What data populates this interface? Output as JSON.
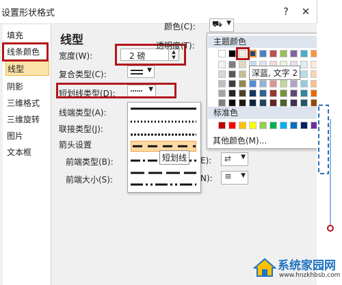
{
  "dialog": {
    "title": "设置形状格式",
    "minimize": "?",
    "close": "✕"
  },
  "nav": {
    "items": [
      "填充",
      "线条颜色",
      "线型",
      "阴影",
      "三维格式",
      "三维旋转",
      "图片",
      "文本框"
    ],
    "selected": "线型"
  },
  "line_style": {
    "heading": "线型",
    "width_label": "宽度(W):",
    "width_value": "2 磅",
    "compound_label": "复合类型(C):",
    "dash_label": "短划线类型(D):",
    "cap_label": "线端类型(A):",
    "join_label": "联接类型(J):",
    "arrow_settings": "箭头设置",
    "begin_type_label": "前端类型(B):",
    "begin_size_label": "前端大小(S):",
    "end_type_suffix": "E):",
    "end_size_suffix": "N):"
  },
  "dash_menu": {
    "tooltip": "短划线",
    "selected_index": 3
  },
  "color": {
    "label": "颜色(C):",
    "transparency_label": "透明度(T):",
    "theme_header": "主题颜色",
    "standard_header": "标准色",
    "more_colors": "其他颜色(M)...",
    "tooltip": "深蓝, 文字 2",
    "theme_top": [
      "#ffffff",
      "#000000",
      "#eeece1",
      "#1f497d",
      "#4f81bd",
      "#c0504d",
      "#9bbb59",
      "#8064a2",
      "#4bacc6",
      "#f79646"
    ],
    "theme_shades": [
      [
        "#f2f2f2",
        "#7f7f7f",
        "#ddd9c3",
        "#c6d9f0",
        "#dbe5f1",
        "#f2dcdb",
        "#ebf1dd",
        "#e5e0ec",
        "#dbeef3",
        "#fdeada"
      ],
      [
        "#d8d8d8",
        "#595959",
        "#c4bd97",
        "#8db3e2",
        "#b8cce4",
        "#e5b9b7",
        "#d7e3bc",
        "#ccc1d9",
        "#b7dde8",
        "#fbd5b5"
      ],
      [
        "#bfbfbf",
        "#3f3f3f",
        "#938953",
        "#548dd4",
        "#95b3d7",
        "#d99694",
        "#c3d69b",
        "#b2a2c7",
        "#92cddc",
        "#fac08f"
      ],
      [
        "#a5a5a5",
        "#262626",
        "#494429",
        "#17365d",
        "#366092",
        "#953734",
        "#76923c",
        "#5f497a",
        "#31859b",
        "#e36c09"
      ],
      [
        "#7f7f7f",
        "#0c0c0c",
        "#1d1b10",
        "#0f243e",
        "#244061",
        "#632423",
        "#4f6128",
        "#3f3151",
        "#205867",
        "#974806"
      ]
    ],
    "standard": [
      "#c00000",
      "#ff0000",
      "#ffc000",
      "#ffff00",
      "#92d050",
      "#00b050",
      "#00b0f0",
      "#0070c0",
      "#002060",
      "#7030a0"
    ],
    "accent": "#b2151a"
  },
  "watermark": {
    "title": "系统家园网",
    "url": "www.hnzkhbsb.com"
  }
}
